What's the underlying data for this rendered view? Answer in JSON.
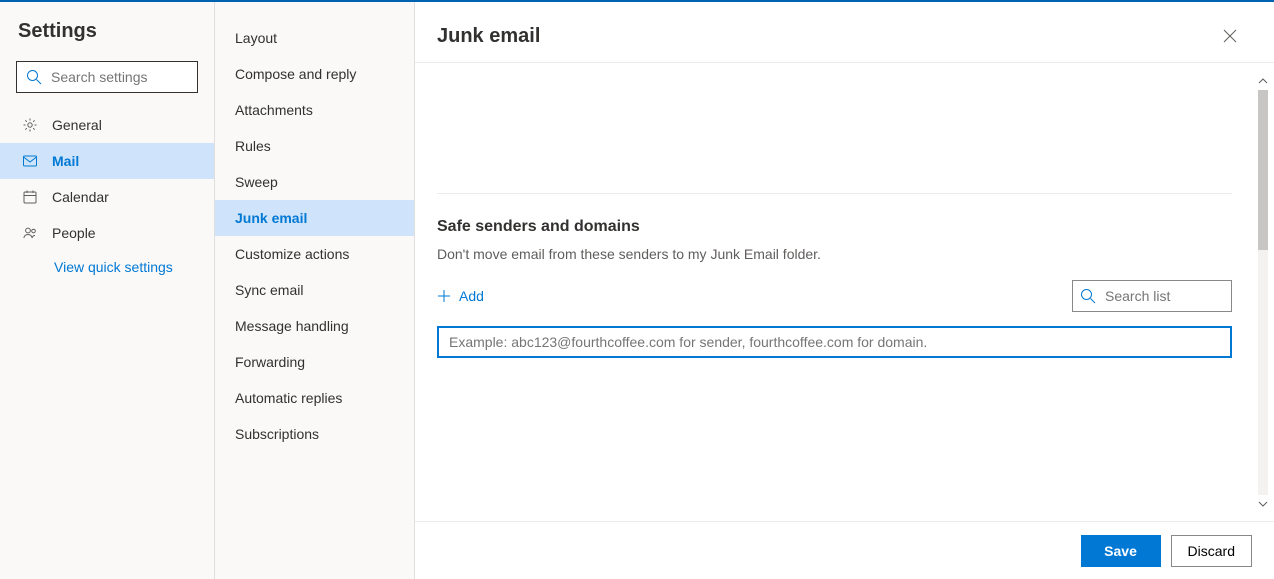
{
  "header": {
    "title": "Settings"
  },
  "search": {
    "placeholder": "Search settings"
  },
  "nav": {
    "items": [
      {
        "label": "General"
      },
      {
        "label": "Mail"
      },
      {
        "label": "Calendar"
      },
      {
        "label": "People"
      }
    ],
    "selected": 1,
    "quick_link": "View quick settings"
  },
  "subnav": {
    "items": [
      {
        "label": "Layout"
      },
      {
        "label": "Compose and reply"
      },
      {
        "label": "Attachments"
      },
      {
        "label": "Rules"
      },
      {
        "label": "Sweep"
      },
      {
        "label": "Junk email"
      },
      {
        "label": "Customize actions"
      },
      {
        "label": "Sync email"
      },
      {
        "label": "Message handling"
      },
      {
        "label": "Forwarding"
      },
      {
        "label": "Automatic replies"
      },
      {
        "label": "Subscriptions"
      }
    ],
    "selected": 5
  },
  "main": {
    "title": "Junk email",
    "section": {
      "title": "Safe senders and domains",
      "desc": "Don't move email from these senders to my Junk Email folder.",
      "add_label": "Add",
      "search_placeholder": "Search list",
      "input_placeholder": "Example: abc123@fourthcoffee.com for sender, fourthcoffee.com for domain."
    },
    "footer": {
      "save": "Save",
      "discard": "Discard"
    }
  }
}
